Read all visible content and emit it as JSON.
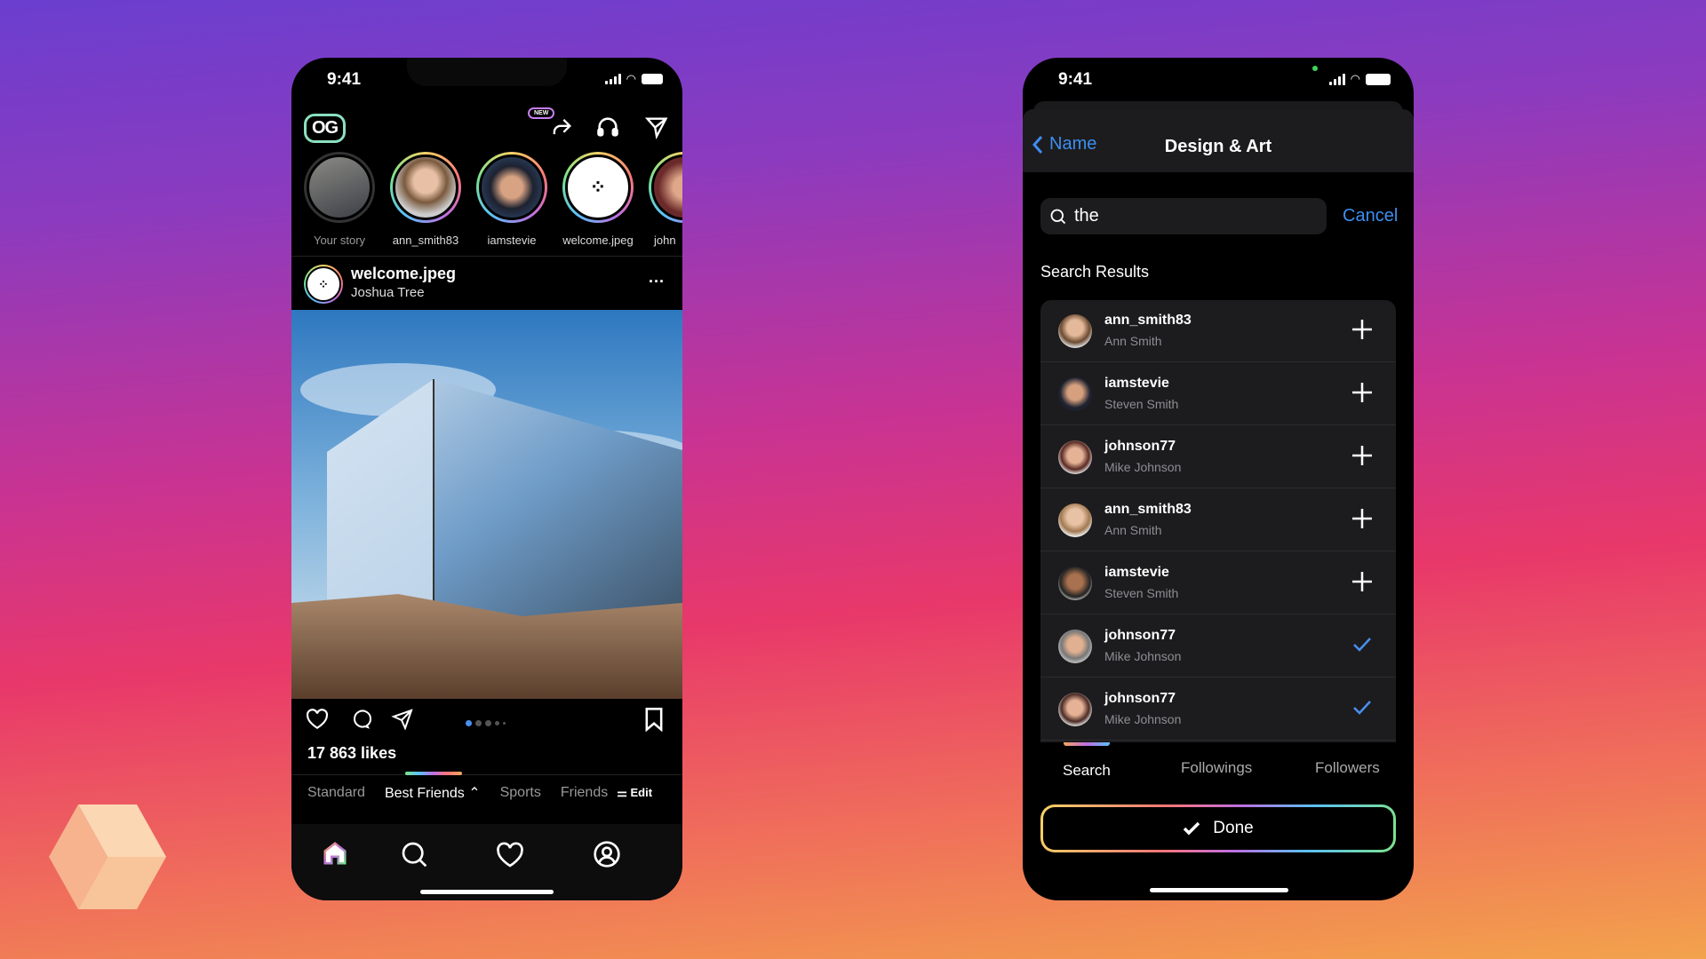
{
  "left_phone": {
    "status_time": "9:41",
    "logo": "OG",
    "header_badge": "NEW",
    "header_icons": [
      "share-icon",
      "headphones-icon",
      "send-icon"
    ],
    "stories": [
      {
        "label": "Your story",
        "own": true
      },
      {
        "label": "ann_smith83"
      },
      {
        "label": "iamstevie"
      },
      {
        "label": "welcome.jpeg"
      },
      {
        "label": "john"
      }
    ],
    "post": {
      "username": "welcome.jpeg",
      "location": "Joshua Tree",
      "more": "···",
      "likes": "17 863 likes",
      "carousel_pages": 5,
      "carousel_current": 1
    },
    "feed_tabs": [
      "Standard",
      "Best Friends",
      "Sports",
      "Friends"
    ],
    "active_tab": "Best Friends",
    "edit_label": "Edit",
    "bottom_nav": [
      "home-icon",
      "search-icon",
      "heart-icon",
      "profile-icon"
    ]
  },
  "right_phone": {
    "status_time": "9:41",
    "back_label": "Name",
    "title": "Design & Art",
    "search": {
      "value": "the",
      "cancel": "Cancel"
    },
    "section_title": "Search Results",
    "results": [
      {
        "username": "ann_smith83",
        "name": "Ann Smith",
        "added": false
      },
      {
        "username": "iamstevie",
        "name": "Steven Smith",
        "added": false
      },
      {
        "username": "johnson77",
        "name": "Mike Johnson",
        "added": false
      },
      {
        "username": "ann_smith83",
        "name": "Ann Smith",
        "added": false
      },
      {
        "username": "iamstevie",
        "name": "Steven Smith",
        "added": false
      },
      {
        "username": "johnson77",
        "name": "Mike Johnson",
        "added": true
      },
      {
        "username": "johnson77",
        "name": "Mike Johnson",
        "added": true
      }
    ],
    "tabs": [
      "Search",
      "Followings",
      "Followers"
    ],
    "active_tab": "Search",
    "done_label": "Done"
  },
  "colors": {
    "accent_blue": "#3d8ef0",
    "card_bg": "#1c1c1e",
    "check_blue": "#4a8ff0"
  }
}
